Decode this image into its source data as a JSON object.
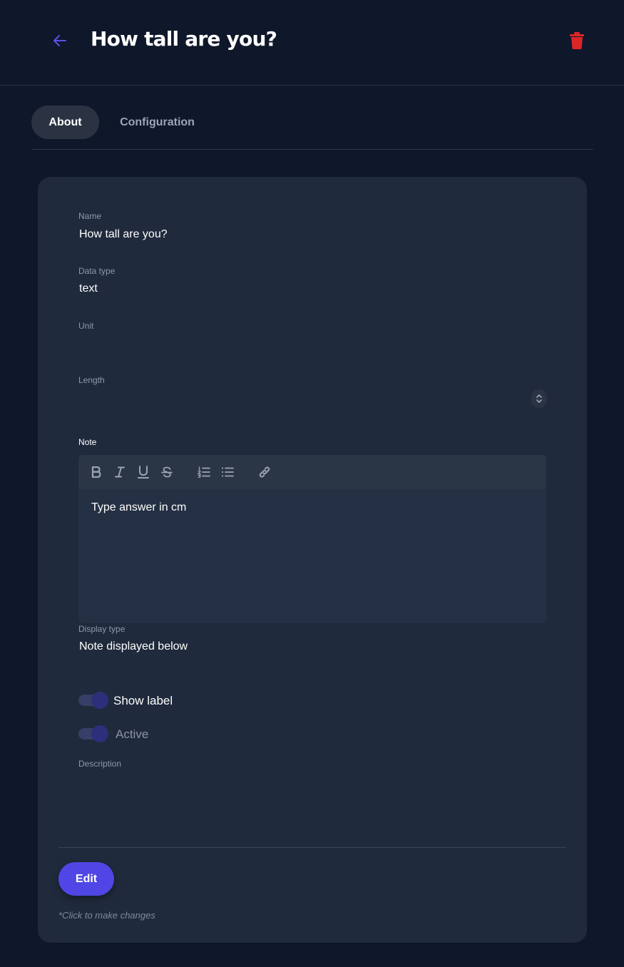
{
  "colors": {
    "background": "#0f172a",
    "card": "#1f2a3c",
    "accent": "#4f46e5",
    "danger": "#dc2626",
    "back_arrow": "#5b50e6"
  },
  "header": {
    "title": "How tall are you?",
    "back_icon": "arrow-left-icon",
    "delete_icon": "trash-icon"
  },
  "tabs": [
    {
      "label": "About",
      "active": true
    },
    {
      "label": "Configuration",
      "active": false
    }
  ],
  "fields": {
    "name": {
      "label": "Name",
      "value": "How tall are you?"
    },
    "data_type": {
      "label": "Data type",
      "value": "text"
    },
    "unit": {
      "label": "Unit",
      "value": ""
    },
    "length": {
      "label": "Length",
      "value": ""
    },
    "note": {
      "label": "Note",
      "content": "Type answer in cm",
      "toolbar": [
        "bold-icon",
        "italic-icon",
        "underline-icon",
        "strikethrough-icon",
        "ordered-list-icon",
        "bullet-list-icon",
        "link-icon"
      ]
    },
    "display_type": {
      "label": "Display type",
      "value": "Note displayed below"
    },
    "show_label": {
      "label": "Show label",
      "on": true
    },
    "active": {
      "label": "Active",
      "on": true
    },
    "description": {
      "label": "Description",
      "value": ""
    }
  },
  "footer": {
    "edit_label": "Edit",
    "hint": "*Click to make changes"
  }
}
